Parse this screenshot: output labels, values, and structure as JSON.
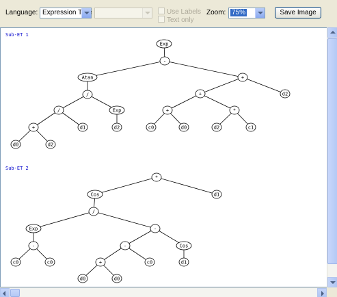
{
  "toolbar": {
    "language_label": "Language:",
    "language_value": "Expression Tree",
    "secondary_value": "",
    "use_labels_label": "Use Labels",
    "text_only_label": "Text only",
    "zoom_label": "Zoom:",
    "zoom_value": "75%",
    "save_label": "Save Image"
  },
  "trees": [
    {
      "title": "Sub-ET 1",
      "nodes": [
        {
          "id": "a1",
          "label": "Exp"
        },
        {
          "id": "a2",
          "label": "-",
          "parent": "a1"
        },
        {
          "id": "a3",
          "label": "Atan",
          "parent": "a2"
        },
        {
          "id": "a4",
          "label": "+",
          "parent": "a2"
        },
        {
          "id": "a5",
          "label": "/",
          "parent": "a3"
        },
        {
          "id": "a6",
          "label": "+",
          "parent": "a4"
        },
        {
          "id": "a7",
          "label": "d2",
          "parent": "a4"
        },
        {
          "id": "a8",
          "label": "/",
          "parent": "a5"
        },
        {
          "id": "a9",
          "label": "Exp",
          "parent": "a5"
        },
        {
          "id": "a10",
          "label": "+",
          "parent": "a6"
        },
        {
          "id": "a11",
          "label": "*",
          "parent": "a6"
        },
        {
          "id": "a12",
          "label": "+",
          "parent": "a8"
        },
        {
          "id": "a13",
          "label": "d1",
          "parent": "a8"
        },
        {
          "id": "a14",
          "label": "d2",
          "parent": "a9"
        },
        {
          "id": "a15",
          "label": "c0",
          "parent": "a10"
        },
        {
          "id": "a16",
          "label": "d0",
          "parent": "a10"
        },
        {
          "id": "a17",
          "label": "d2",
          "parent": "a11"
        },
        {
          "id": "a18",
          "label": "c1",
          "parent": "a11"
        },
        {
          "id": "a19",
          "label": "d0",
          "parent": "a12"
        },
        {
          "id": "a20",
          "label": "d2",
          "parent": "a12"
        }
      ]
    },
    {
      "title": "Sub-ET 2",
      "nodes": [
        {
          "id": "b1",
          "label": "*"
        },
        {
          "id": "b2",
          "label": "Cos",
          "parent": "b1"
        },
        {
          "id": "b3",
          "label": "d1",
          "parent": "b1"
        },
        {
          "id": "b4",
          "label": "/",
          "parent": "b2"
        },
        {
          "id": "b5",
          "label": "Exp",
          "parent": "b4"
        },
        {
          "id": "b6",
          "label": "-",
          "parent": "b4"
        },
        {
          "id": "b7",
          "label": "-",
          "parent": "b5"
        },
        {
          "id": "b8",
          "label": "-",
          "parent": "b6"
        },
        {
          "id": "b9",
          "label": "Cos",
          "parent": "b6"
        },
        {
          "id": "b10",
          "label": "c0",
          "parent": "b7"
        },
        {
          "id": "b11",
          "label": "c0",
          "parent": "b7"
        },
        {
          "id": "b12",
          "label": "+",
          "parent": "b8"
        },
        {
          "id": "b13",
          "label": "c0",
          "parent": "b8"
        },
        {
          "id": "b14",
          "label": "d1",
          "parent": "b9"
        },
        {
          "id": "b15",
          "label": "d0",
          "parent": "b12"
        },
        {
          "id": "b16",
          "label": "d0",
          "parent": "b12"
        }
      ]
    }
  ]
}
